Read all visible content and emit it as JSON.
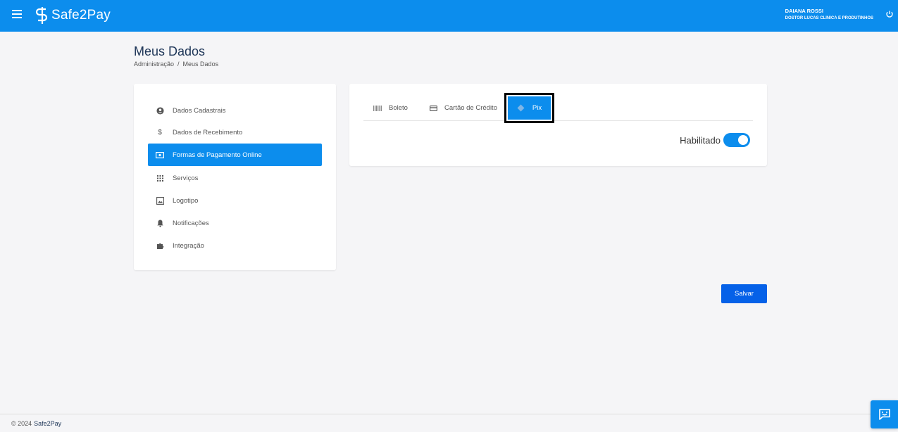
{
  "brand": {
    "name": "Safe2Pay",
    "color": "#0c8ded"
  },
  "user": {
    "name": "DAIANA ROSSI",
    "company": "DOSTOR LUCAS CLINICA E PRODUTINHOS"
  },
  "page": {
    "title": "Meus Dados",
    "breadcrumb": [
      "Administração",
      "/",
      "Meus Dados"
    ]
  },
  "sidebar": {
    "items": [
      {
        "label": "Dados Cadastrais",
        "icon": "account-circle-icon",
        "active": false
      },
      {
        "label": "Dados de Recebimento",
        "icon": "dollar-icon",
        "active": false
      },
      {
        "label": "Formas de Pagamento Online",
        "icon": "money-icon",
        "active": true
      },
      {
        "label": "Serviços",
        "icon": "grid-icon",
        "active": false
      },
      {
        "label": "Logotipo",
        "icon": "image-icon",
        "active": false
      },
      {
        "label": "Notificações",
        "icon": "bell-icon",
        "active": false
      },
      {
        "label": "Integração",
        "icon": "puzzle-icon",
        "active": false
      }
    ]
  },
  "tabs": [
    {
      "label": "Boleto",
      "icon": "barcode-icon",
      "active": false
    },
    {
      "label": "Cartão de Crédito",
      "icon": "credit-card-icon",
      "active": false
    },
    {
      "label": "Pix",
      "icon": "pix-icon",
      "active": true
    }
  ],
  "toggle": {
    "label": "Habilitado",
    "enabled": true
  },
  "actions": {
    "save_label": "Salvar"
  },
  "footer": {
    "copyright": "© 2024",
    "brand": "Safe2Pay"
  }
}
